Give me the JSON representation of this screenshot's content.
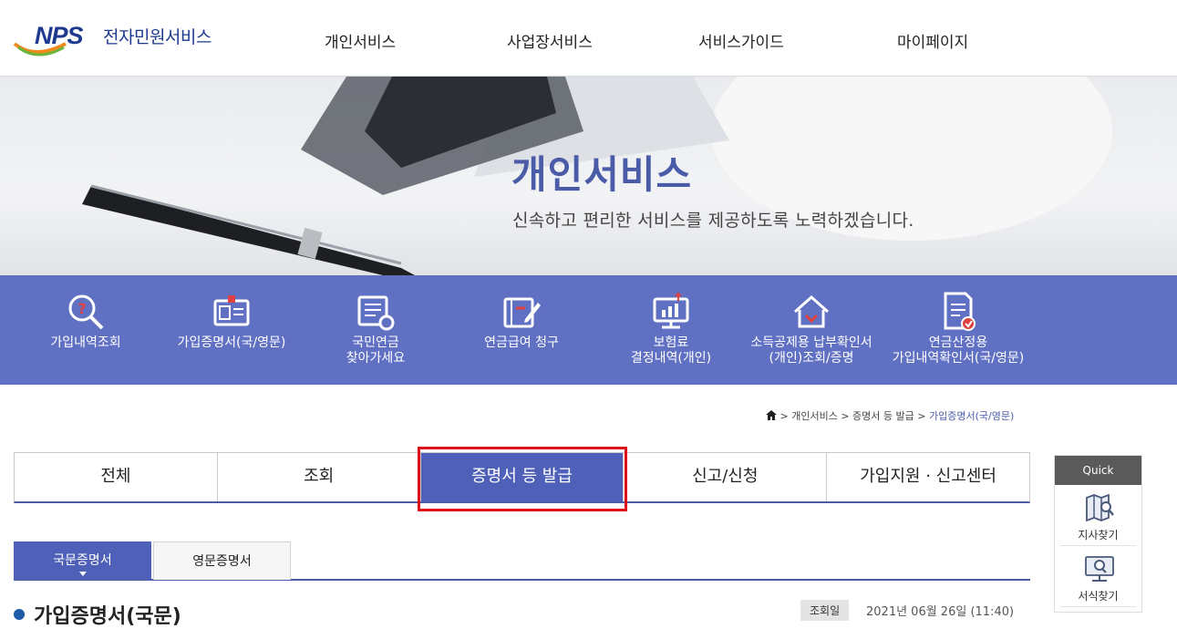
{
  "header": {
    "logo_brand": "NPS",
    "logo_text": "전자민원서비스",
    "nav": [
      "개인서비스",
      "사업장서비스",
      "서비스가이드",
      "마이페이지"
    ]
  },
  "hero": {
    "title": "개인서비스",
    "subtitle": "신속하고 편리한 서비스를 제공하도록 노력하겠습니다."
  },
  "quick_services": [
    {
      "label": "가입내역조회",
      "icon": "search-question-icon"
    },
    {
      "label": "가입증명서(국/영문)",
      "icon": "id-card-icon"
    },
    {
      "label": "국민연금\n찾아가세요",
      "icon": "document-search-icon"
    },
    {
      "label": "연금급여 청구",
      "icon": "form-pen-icon"
    },
    {
      "label": "보험료\n결정내역(개인)",
      "icon": "monitor-chart-icon"
    },
    {
      "label": "소득공제용 납부확인서\n(개인)조회/증명",
      "icon": "house-icon"
    },
    {
      "label": "연금산정용\n가입내역확인서(국/영문)",
      "icon": "document-check-icon"
    }
  ],
  "breadcrumb": {
    "items": [
      "개인서비스",
      "증명서 등 발급",
      "가입증명서(국/영문)"
    ],
    "separator": ">"
  },
  "tabs": [
    "전체",
    "조회",
    "증명서 등 발급",
    "신고/신청",
    "가입지원 · 신고센터"
  ],
  "active_tab": "증명서 등 발급",
  "subtabs": [
    "국문증명서",
    "영문증명서"
  ],
  "active_subtab": "국문증명서",
  "doc": {
    "title": "가입증명서(국문)",
    "views_label": "조회일",
    "date": "2021년 06월 26일 (11:40)"
  },
  "quick_panel": {
    "title": "Quick",
    "items": [
      "지사찾기",
      "서식찾기"
    ]
  },
  "colors": {
    "brand_blue": "#4a5ba8",
    "quickbar_bg": "#6070c3",
    "active_tab_bg": "#4f60b8",
    "highlight_red": "#e0101a"
  }
}
